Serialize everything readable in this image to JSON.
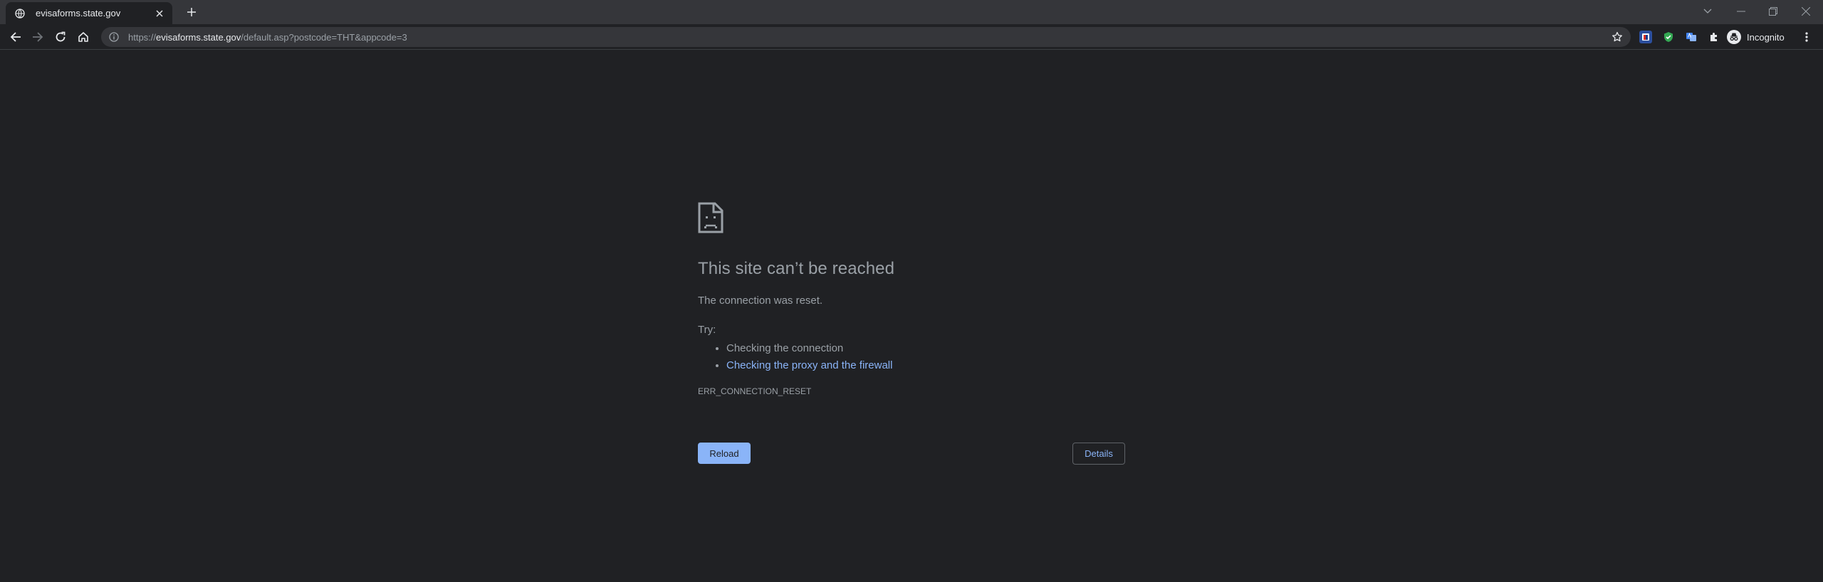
{
  "tab": {
    "title": "evisaforms.state.gov",
    "favicon": "globe-icon"
  },
  "window_controls": [
    "chevron-down-icon",
    "minimize-icon",
    "restore-icon",
    "close-icon"
  ],
  "toolbar": {
    "url_scheme": "https://",
    "url_host": "evisaforms.state.gov",
    "url_path": "/default.asp?postcode=THT&appcode=3",
    "profile_label": "Incognito",
    "extensions": [
      "privacy-badger-icon",
      "adblock-shield-icon",
      "translate-icon",
      "extensions-puzzle-icon"
    ]
  },
  "error": {
    "title": "This site can’t be reached",
    "message": "The connection was reset.",
    "try_label": "Try:",
    "suggestions": [
      {
        "text": "Checking the connection",
        "link": false
      },
      {
        "text": "Checking the proxy and the firewall",
        "link": true
      }
    ],
    "code": "ERR_CONNECTION_RESET",
    "reload_label": "Reload",
    "details_label": "Details"
  },
  "colors": {
    "background": "#202124",
    "tabstrip": "#35363a",
    "text": "#9aa0a6",
    "link": "#8ab4f8"
  }
}
